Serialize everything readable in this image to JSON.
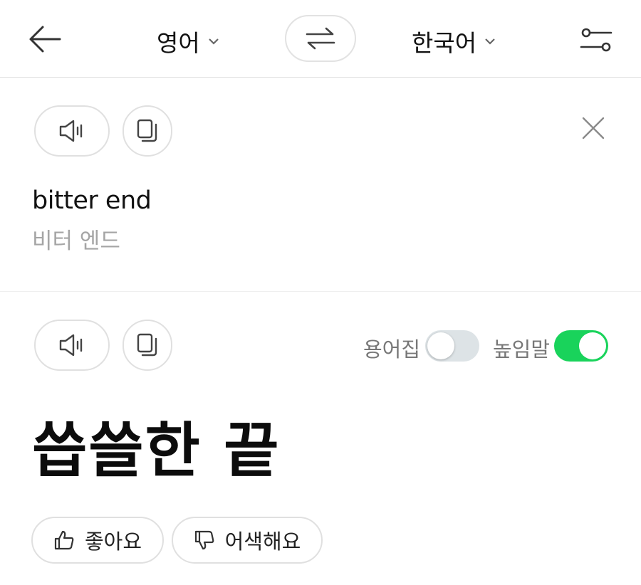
{
  "header": {
    "source_lang": "영어",
    "target_lang": "한국어"
  },
  "source": {
    "text": "bitter end",
    "pronunciation": "비터 엔드"
  },
  "result": {
    "text": "씁쓸한 끝",
    "toggles": [
      {
        "label": "용어집",
        "on": false
      },
      {
        "label": "높임말",
        "on": true
      }
    ]
  },
  "feedback": {
    "like_label": "좋아요",
    "dislike_label": "어색해요"
  },
  "colors": {
    "accent_green": "#19d35b",
    "toggle_off": "#dde3e6"
  },
  "icons": [
    "back-arrow-icon",
    "chevron-down-icon",
    "swap-icon",
    "settings-sliders-icon",
    "speaker-icon",
    "copy-icon",
    "close-icon",
    "thumbs-up-icon",
    "thumbs-down-icon"
  ]
}
